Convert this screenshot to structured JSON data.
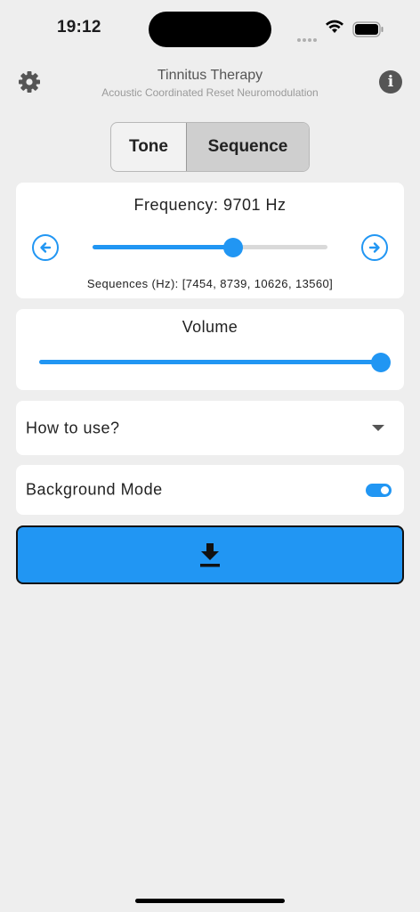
{
  "status_bar": {
    "time": "19:12"
  },
  "header": {
    "title": "Tinnitus Therapy",
    "subtitle": "Acoustic Coordinated Reset Neuromodulation",
    "settings_icon": "gear-icon",
    "info_icon": "info-icon"
  },
  "mode_tabs": {
    "items": [
      {
        "label": "Tone",
        "selected": false
      },
      {
        "label": "Sequence",
        "selected": true
      }
    ]
  },
  "frequency": {
    "label": "Frequency: 9701 Hz",
    "slider_fraction": 0.6,
    "sequences_text": "Sequences (Hz): [7454, 8739, 10626, 13560]",
    "prev_icon": "arrow-left-circle-icon",
    "next_icon": "arrow-right-circle-icon"
  },
  "volume": {
    "label": "Volume",
    "slider_fraction": 1.0
  },
  "how_to_use": {
    "label": "How to use?",
    "icon": "chevron-down-icon"
  },
  "background_mode": {
    "label": "Background Mode",
    "enabled": true
  },
  "download_button": {
    "icon": "download-icon"
  },
  "colors": {
    "accent": "#2196f3",
    "background": "#eeeeee",
    "card": "#ffffff"
  }
}
